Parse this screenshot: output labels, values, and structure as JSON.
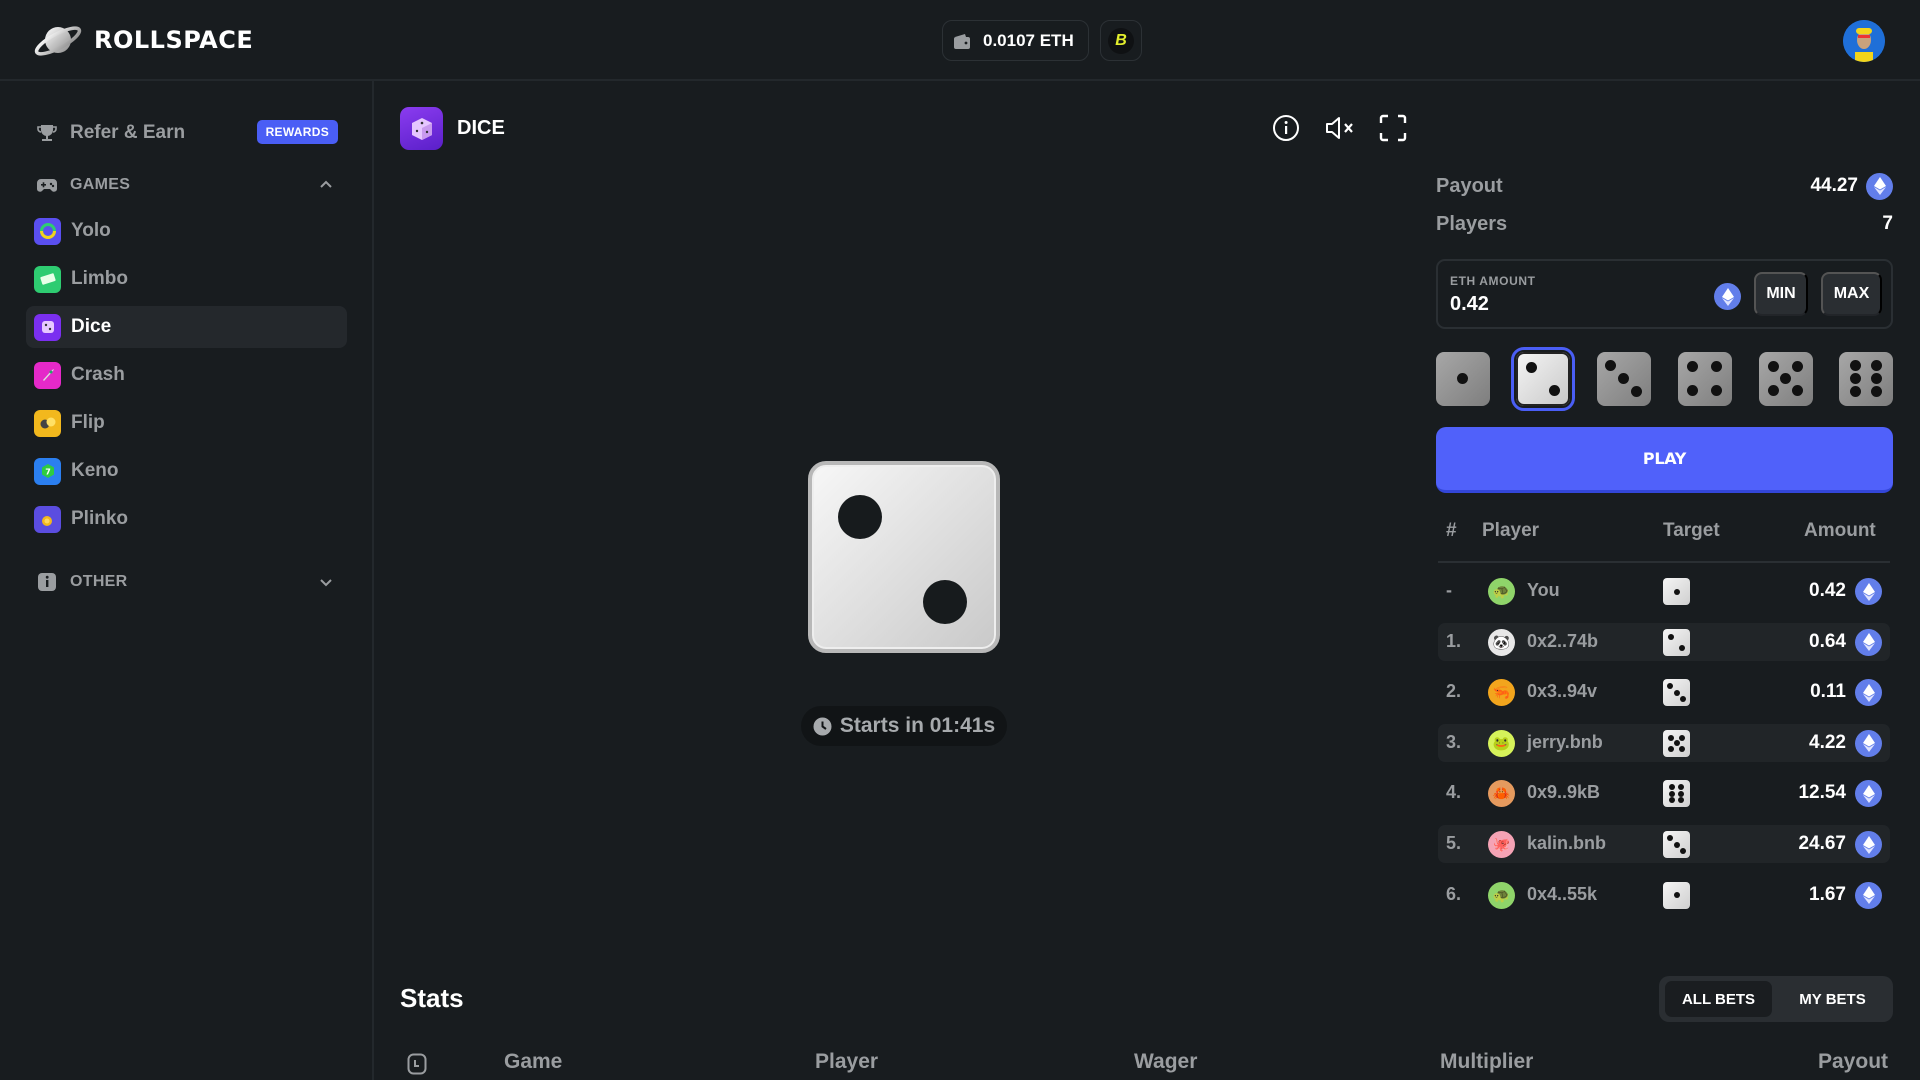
{
  "brand": {
    "name": "ROLLSPACE"
  },
  "header": {
    "wallet_balance": "0.0107 ETH",
    "chain_symbol": "B",
    "wallet_icon": "wallet-icon",
    "avatar_icon": "ape-avatar"
  },
  "sidebar": {
    "refer": {
      "label": "Refer & Earn",
      "badge": "REWARDS",
      "icon": "trophy-icon"
    },
    "games_section": {
      "label": "GAMES",
      "icon": "gamepad-icon",
      "expanded": true
    },
    "games": [
      {
        "label": "Yolo",
        "icon": "yolo-icon",
        "color": "#5a4ff0",
        "active": false
      },
      {
        "label": "Limbo",
        "icon": "limbo-icon",
        "color": "#2ecc71",
        "active": false
      },
      {
        "label": "Dice",
        "icon": "dice-icon",
        "color": "#7b2ff0",
        "active": true
      },
      {
        "label": "Crash",
        "icon": "rocket-icon",
        "color": "#e529c9",
        "active": false
      },
      {
        "label": "Flip",
        "icon": "coin-flip-icon",
        "color": "#f2b81d",
        "active": false
      },
      {
        "label": "Keno",
        "icon": "keno-icon",
        "color": "#2b7ff0",
        "active": false
      },
      {
        "label": "Plinko",
        "icon": "plinko-icon",
        "color": "#5b4de0",
        "active": false
      }
    ],
    "other_section": {
      "label": "OTHER",
      "icon": "info-icon",
      "expanded": false
    }
  },
  "game": {
    "title": "DICE",
    "current_face": 2,
    "countdown": "Starts in 01:41s"
  },
  "panel": {
    "payout_label": "Payout",
    "payout_value": "44.27",
    "players_label": "Players",
    "players_value": "7",
    "amount_caption": "ETH AMOUNT",
    "amount_value": "0.42",
    "min_label": "MIN",
    "max_label": "MAX",
    "dice_options": [
      1,
      2,
      3,
      4,
      5,
      6
    ],
    "selected_face": 2,
    "play_label": "PLAY"
  },
  "leaderboard": {
    "headers": {
      "rank": "#",
      "player": "Player",
      "target": "Target",
      "amount": "Amount"
    },
    "rows": [
      {
        "rank": "-",
        "player": "You",
        "avatar": "turtle",
        "avatar_bg": "#8fd46a",
        "target": 1,
        "amount": "0.42"
      },
      {
        "rank": "1.",
        "player": "0x2..74b",
        "avatar": "panda",
        "avatar_bg": "#e8e8e8",
        "target": 2,
        "amount": "0.64"
      },
      {
        "rank": "2.",
        "player": "0x3..94v",
        "avatar": "shrimp",
        "avatar_bg": "#f2a51d",
        "target": 3,
        "amount": "0.11"
      },
      {
        "rank": "3.",
        "player": "jerry.bnb",
        "avatar": "frog",
        "avatar_bg": "#d6f25a",
        "target": 5,
        "amount": "4.22"
      },
      {
        "rank": "4.",
        "player": "0x9..9kB",
        "avatar": "crab",
        "avatar_bg": "#e59a5e",
        "target": 6,
        "amount": "12.54"
      },
      {
        "rank": "5.",
        "player": "kalin.bnb",
        "avatar": "octopus",
        "avatar_bg": "#f5a3b5",
        "target": 3,
        "amount": "24.67"
      },
      {
        "rank": "6.",
        "player": "0x4..55k",
        "avatar": "turtle",
        "avatar_bg": "#8fd46a",
        "target": 1,
        "amount": "1.67"
      }
    ]
  },
  "stats": {
    "title": "Stats",
    "tabs": [
      {
        "label": "ALL BETS",
        "active": true
      },
      {
        "label": "MY BETS",
        "active": false
      }
    ],
    "columns": [
      "Game",
      "Player",
      "Wager",
      "Multiplier",
      "Payout"
    ]
  },
  "colors": {
    "accent": "#5061fa",
    "eth": "#627eea",
    "bg": "#181c1f"
  }
}
